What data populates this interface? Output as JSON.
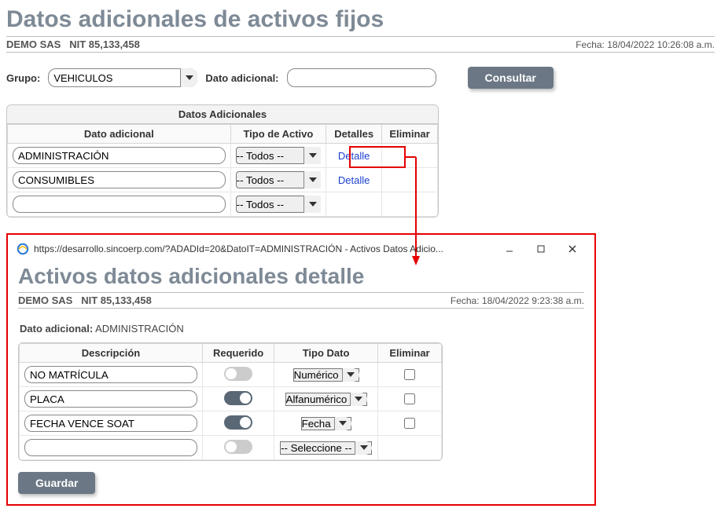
{
  "header": {
    "title": "Datos adicionales de activos fijos",
    "company": "DEMO SAS",
    "nit_label": "NIT",
    "nit": "85,133,458",
    "date_label": "Fecha:",
    "date": "18/04/2022 10:26:08 a.m."
  },
  "filters": {
    "grupo_label": "Grupo:",
    "grupo_value": "VEHICULOS",
    "dato_label": "Dato adicional:",
    "dato_value": "",
    "consultar": "Consultar"
  },
  "grid": {
    "title": "Datos Adicionales",
    "col_dato": "Dato adicional",
    "col_tipo": "Tipo de Activo",
    "col_detalles": "Detalles",
    "col_eliminar": "Eliminar",
    "tipo_default": "-- Todos --",
    "detail_link": "Detalle",
    "rows": [
      {
        "dato": "ADMINISTRACIÓN",
        "tipo": "-- Todos --",
        "has_detail": true
      },
      {
        "dato": "CONSUMIBLES",
        "tipo": "-- Todos --",
        "has_detail": true
      },
      {
        "dato": "",
        "tipo": "-- Todos --",
        "has_detail": false
      }
    ]
  },
  "popup": {
    "url_text": "https://desarrollo.sincoerp.com/?ADADId=20&DatoIT=ADMINISTRACIÓN - Activos Datos Adicio...",
    "title": "Activos datos adicionales detalle",
    "company": "DEMO SAS",
    "nit_label": "NIT",
    "nit": "85,133,458",
    "date_label": "Fecha:",
    "date": "18/04/2022 9:23:38 a.m.",
    "dato_adicional_label": "Dato adicional:",
    "dato_adicional_value": "ADMINISTRACIÓN",
    "col_desc": "Descripción",
    "col_req": "Requerido",
    "col_tipo": "Tipo Dato",
    "col_elim": "Eliminar",
    "tipo_default": "-- Seleccione --",
    "rows": [
      {
        "desc": "NO MATRÍCULA",
        "req": false,
        "tipo": "Numérico"
      },
      {
        "desc": "PLACA",
        "req": true,
        "tipo": "Alfanumérico"
      },
      {
        "desc": "FECHA VENCE SOAT",
        "req": true,
        "tipo": "Fecha"
      },
      {
        "desc": "",
        "req": false,
        "tipo": "-- Seleccione --"
      }
    ],
    "guardar": "Guardar"
  }
}
